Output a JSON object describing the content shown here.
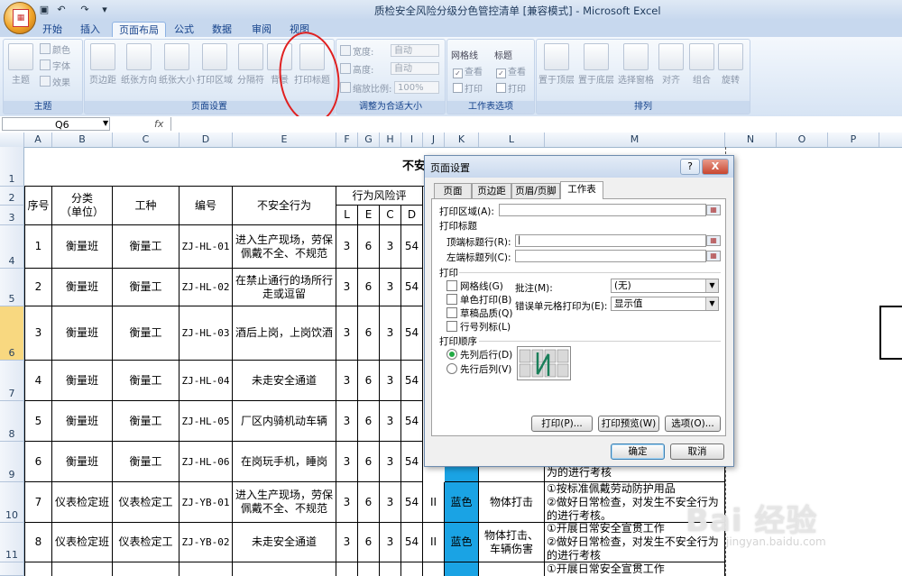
{
  "window": {
    "title": "质检安全风险分级分色管控清单  [兼容模式] - Microsoft Excel"
  },
  "tabs": [
    "开始",
    "插入",
    "页面布局",
    "公式",
    "数据",
    "审阅",
    "视图"
  ],
  "ribbon": {
    "theme_group": {
      "label": "主题",
      "theme": "主题",
      "colors": "颜色",
      "fonts": "字体",
      "effects": "效果"
    },
    "page_setup_group": {
      "label": "页面设置",
      "margins": "页边距",
      "orientation": "纸张方向",
      "size": "纸张大小",
      "print_area": "打印区域",
      "breaks": "分隔符",
      "background": "背景",
      "print_titles": "打印标题"
    },
    "scale_group": {
      "label": "调整为合适大小",
      "width": "宽度:",
      "width_value": "自动",
      "height": "高度:",
      "height_value": "自动",
      "scale": "缩放比例:",
      "scale_value": "100%"
    },
    "sheet_options_group": {
      "label": "工作表选项",
      "gridlines": "网格线",
      "headings": "标题",
      "view": "查看",
      "print": "打印"
    },
    "arrange_group": {
      "label": "排列",
      "bring_front": "置于顶层",
      "send_back": "置于底层",
      "selection_pane": "选择窗格",
      "align": "对齐",
      "group": "组合",
      "rotate": "旋转"
    }
  },
  "formula_bar": {
    "name_box": "Q6",
    "fx": "fx"
  },
  "columns": [
    "A",
    "B",
    "C",
    "D",
    "E",
    "F",
    "G",
    "H",
    "I",
    "J",
    "K",
    "L",
    "M",
    "N",
    "O",
    "P"
  ],
  "rows": [
    "1",
    "2",
    "3",
    "4",
    "5",
    "6",
    "7",
    "8",
    "9",
    "10",
    "11"
  ],
  "sheet": {
    "title": "不安全行为管控清单",
    "headers": {
      "no": "序号",
      "category": "分类\n（单位）",
      "job": "工种",
      "code": "编号",
      "behavior": "不安全行为",
      "risk": "行为风险评",
      "L": "L",
      "E": "E",
      "C": "C",
      "D": "D"
    },
    "data_rows": [
      {
        "no": "1",
        "category": "衡量班",
        "job": "衡量工",
        "code": "ZJ-HL-01",
        "behavior": "进入生产现场，劳保佩戴不全、不规范",
        "L": "3",
        "E": "6",
        "C": "3",
        "D": "54"
      },
      {
        "no": "2",
        "category": "衡量班",
        "job": "衡量工",
        "code": "ZJ-HL-02",
        "behavior": "在禁止通行的场所行走或逗留",
        "L": "3",
        "E": "6",
        "C": "3",
        "D": "54"
      },
      {
        "no": "3",
        "category": "衡量班",
        "job": "衡量工",
        "code": "ZJ-HL-03",
        "behavior": "酒后上岗，上岗饮酒",
        "L": "3",
        "E": "6",
        "C": "3",
        "D": "54"
      },
      {
        "no": "4",
        "category": "衡量班",
        "job": "衡量工",
        "code": "ZJ-HL-04",
        "behavior": "未走安全通道",
        "L": "3",
        "E": "6",
        "C": "3",
        "D": "54"
      },
      {
        "no": "5",
        "category": "衡量班",
        "job": "衡量工",
        "code": "ZJ-HL-05",
        "behavior": "厂区内骑机动车辆",
        "L": "3",
        "E": "6",
        "C": "3",
        "D": "54"
      },
      {
        "no": "6",
        "category": "衡量班",
        "job": "衡量工",
        "code": "ZJ-HL-06",
        "behavior": "在岗玩手机，睡岗",
        "L": "3",
        "E": "6",
        "C": "3",
        "D": "54",
        "M_tail": "为的进行考核"
      },
      {
        "no": "7",
        "category": "仪表检定班",
        "job": "仪表检定工",
        "code": "ZJ-YB-01",
        "behavior": "进入生产现场，劳保佩戴不全、不规范",
        "L": "3",
        "E": "6",
        "C": "3",
        "D": "54",
        "J": "II",
        "K": "蓝色",
        "L_col": "物体打击",
        "M": "①按标准佩戴劳动防护用品\n②做好日常检查，对发生不安全行为的进行考核。"
      },
      {
        "no": "8",
        "category": "仪表检定班",
        "job": "仪表检定工",
        "code": "ZJ-YB-02",
        "behavior": "未走安全通道",
        "L": "3",
        "E": "6",
        "C": "3",
        "D": "54",
        "J": "II",
        "K": "蓝色",
        "L_col": "物体打击、车辆伤害",
        "M": "①开展日常安全宣贯工作\n②做好日常检查，对发生不安全行为的进行考核"
      }
    ],
    "partial_row_text": "①开展日常安全宣贯工作"
  },
  "dialog": {
    "title": "页面设置",
    "help": "?",
    "close": "X",
    "tabs": [
      "页面",
      "页边距",
      "页眉/页脚",
      "工作表"
    ],
    "print_area": "打印区域(A):",
    "print_titles": "打印标题",
    "rows_to_repeat": "顶端标题行(R):",
    "cols_to_repeat": "左端标题列(C):",
    "print_section": "打印",
    "gridlines": "网格线(G)",
    "black_white": "单色打印(B)",
    "draft": "草稿品质(Q)",
    "row_col_headings": "行号列标(L)",
    "comments_label": "批注(M):",
    "comments_value": "(无)",
    "errors_label": "错误单元格打印为(E):",
    "errors_value": "显示值",
    "page_order": "打印顺序",
    "down_then_over": "先列后行(D)",
    "over_then_down": "先行后列(V)",
    "btn_print": "打印(P)...",
    "btn_preview": "打印预览(W)",
    "btn_options": "选项(O)...",
    "btn_ok": "确定",
    "btn_cancel": "取消"
  },
  "watermark": {
    "main": "Bai 经验",
    "sub": "jingyan.baidu.com"
  },
  "colors": {
    "blue_cell": "#1aa3e4",
    "annotation": "#e02020"
  }
}
